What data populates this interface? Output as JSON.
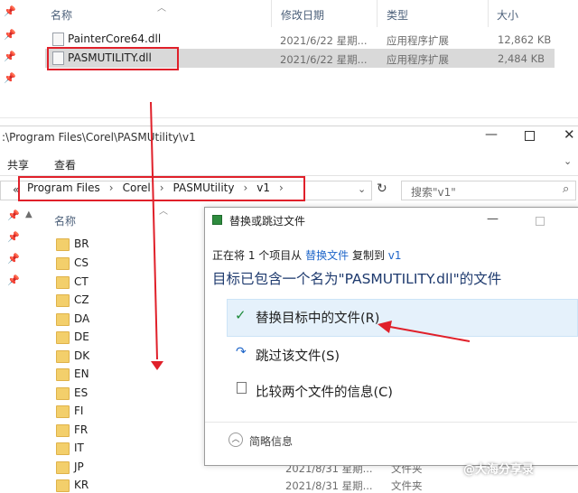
{
  "top_explorer": {
    "headers": {
      "name": "名称",
      "modified": "修改日期",
      "type": "类型",
      "size": "大小"
    },
    "files": [
      {
        "name": "PainterCore64.dll",
        "modified": "2021/6/22 星期...",
        "type": "应用程序扩展",
        "size": "12,862 KB"
      },
      {
        "name": "PASMUTILITY.dll",
        "modified": "2021/6/22 星期...",
        "type": "应用程序扩展",
        "size": "2,484 KB"
      }
    ]
  },
  "bottom_explorer": {
    "title": ":\\Program Files\\Corel\\PASMUtility\\v1",
    "menu": {
      "share": "共享",
      "view": "查看"
    },
    "breadcrumb": [
      "Program Files",
      "Corel",
      "PASMUtility",
      "v1"
    ],
    "search_placeholder": "搜索\"v1\"",
    "name_header": "名称",
    "folders": [
      "BR",
      "CS",
      "CT",
      "CZ",
      "DA",
      "DE",
      "DK",
      "EN",
      "ES",
      "FI",
      "FR",
      "IT",
      "JP",
      "KR"
    ],
    "bottom_rows": [
      {
        "modified": "2021/8/31 星期...",
        "type": "文件夹"
      },
      {
        "modified": "2021/8/31 星期...",
        "type": "文件夹"
      }
    ]
  },
  "dialog": {
    "title": "替换或跳过文件",
    "copy_prefix": "正在将 1 个项目从",
    "copy_source": "替换文件",
    "copy_middle": "复制到",
    "copy_dest": "v1",
    "heading": "目标已包含一个名为\"PASMUTILITY.dll\"的文件",
    "option_replace": "替换目标中的文件(R)",
    "option_skip": "跳过该文件(S)",
    "option_compare": "比较两个文件的信息(C)",
    "details": "简略信息"
  },
  "watermark": "@大海分享录",
  "colors": {
    "annotation_red": "#e0202a",
    "link_blue": "#1f66c9",
    "highlight_blue": "#e5f1fb"
  }
}
